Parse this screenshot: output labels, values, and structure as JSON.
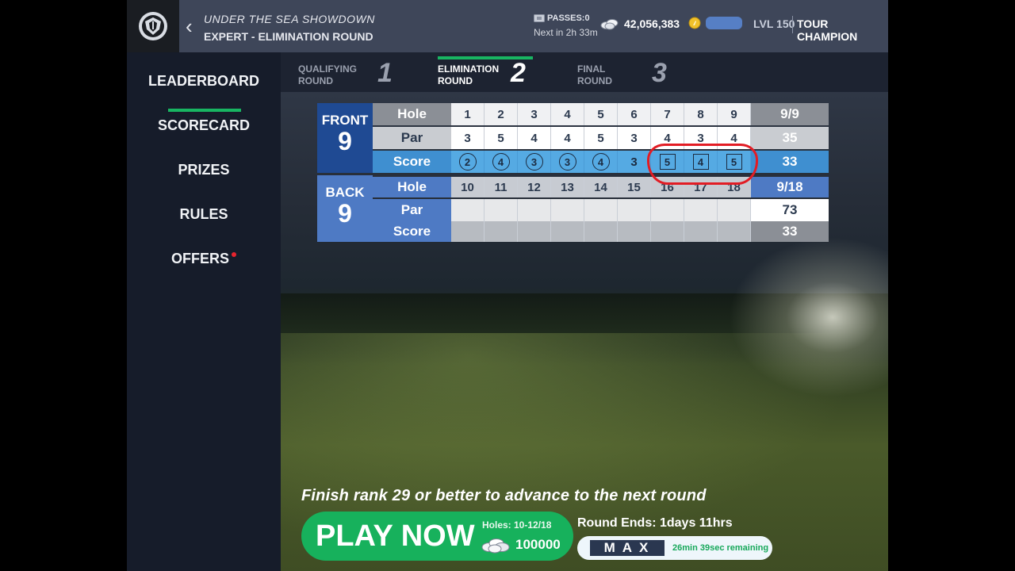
{
  "header": {
    "event_title": "UNDER THE SEA SHOWDOWN",
    "subtitle": "EXPERT - ELIMINATION ROUND",
    "passes": "PASSES:0",
    "next_in": "Next in  2h 33m",
    "coins": "42,056,383",
    "level": "LVL 150",
    "rank_title": "TOUR CHAMPION"
  },
  "sidebar": {
    "items": [
      {
        "label": "LEADERBOARD"
      },
      {
        "label": "SCORECARD"
      },
      {
        "label": "PRIZES"
      },
      {
        "label": "RULES"
      },
      {
        "label": "OFFERS"
      }
    ],
    "active": "SCORECARD"
  },
  "rounds": [
    {
      "label": "QUALIFYING\nROUND",
      "num": "1"
    },
    {
      "label": "ELIMINATION\nROUND",
      "num": "2"
    },
    {
      "label": "FINAL\nROUND",
      "num": "3"
    }
  ],
  "scorecard": {
    "front": {
      "badge": "FRONT",
      "badge_num": "9",
      "hole_label": "Hole",
      "par_label": "Par",
      "score_label": "Score",
      "holes": [
        "1",
        "2",
        "3",
        "4",
        "5",
        "6",
        "7",
        "8",
        "9"
      ],
      "par": [
        "3",
        "5",
        "4",
        "4",
        "5",
        "3",
        "4",
        "3",
        "4"
      ],
      "score": [
        "2",
        "4",
        "3",
        "3",
        "4",
        "3",
        "5",
        "4",
        "5"
      ],
      "score_marks": [
        "circle",
        "circle",
        "circle",
        "circle",
        "circle",
        "none",
        "square",
        "square",
        "square"
      ],
      "hole_total": "9/9",
      "par_total": "35",
      "score_total": "33"
    },
    "back": {
      "badge": "BACK",
      "badge_num": "9",
      "hole_label": "Hole",
      "par_label": "Par",
      "score_label": "Score",
      "holes": [
        "10",
        "11",
        "12",
        "13",
        "14",
        "15",
        "16",
        "17",
        "18"
      ],
      "hole_total": "9/18",
      "par_total": "73",
      "score_total": "33"
    }
  },
  "footer": {
    "advance_text": "Finish rank 29 or better to advance to the next round",
    "play_label": "PLAY NOW",
    "holes_info": "Holes: 10-12/18",
    "cost": "100000",
    "round_ends": "Round Ends:  1days 11hrs",
    "max_label": "MAX",
    "max_remaining": "26min 39sec remaining"
  },
  "colors": {
    "accent_green": "#17b15c",
    "front_blue": "#1f4a93",
    "back_blue": "#4e7ac4",
    "annotation_red": "#e21c24"
  }
}
